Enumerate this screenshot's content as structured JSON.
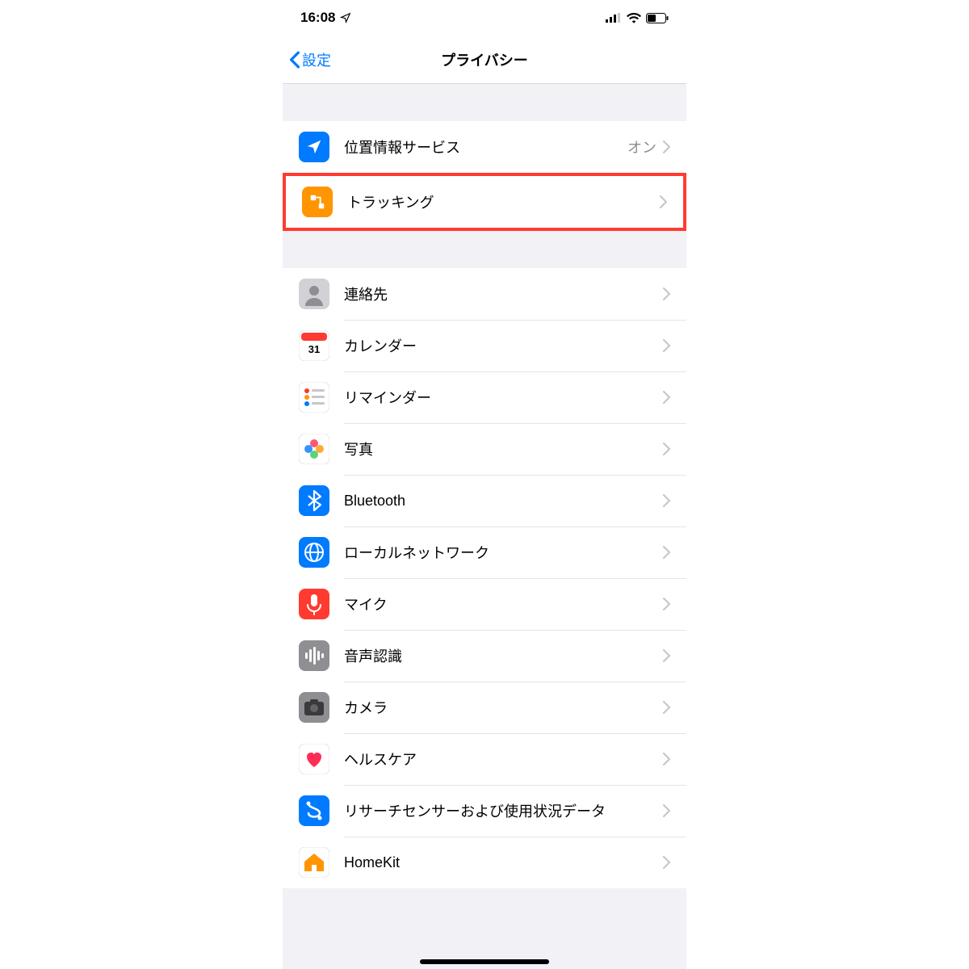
{
  "status": {
    "time": "16:08"
  },
  "nav": {
    "back": "設定",
    "title": "プライバシー"
  },
  "section1": [
    {
      "label": "位置情報サービス",
      "value": "オン",
      "icon": "location",
      "bg": "#007aff"
    },
    {
      "label": "トラッキング",
      "value": "",
      "icon": "tracking",
      "bg": "#ff9500",
      "highlight": true
    }
  ],
  "section2": [
    {
      "label": "連絡先",
      "icon": "contacts",
      "bg": "#c7c7cc"
    },
    {
      "label": "カレンダー",
      "icon": "calendar",
      "bg": "#ffffff"
    },
    {
      "label": "リマインダー",
      "icon": "reminders",
      "bg": "#ffffff"
    },
    {
      "label": "写真",
      "icon": "photos",
      "bg": "#ffffff"
    },
    {
      "label": "Bluetooth",
      "icon": "bluetooth",
      "bg": "#007aff"
    },
    {
      "label": "ローカルネットワーク",
      "icon": "network",
      "bg": "#007aff"
    },
    {
      "label": "マイク",
      "icon": "mic",
      "bg": "#ff3b30"
    },
    {
      "label": "音声認識",
      "icon": "speech",
      "bg": "#8e8e93"
    },
    {
      "label": "カメラ",
      "icon": "camera",
      "bg": "#8e8e93"
    },
    {
      "label": "ヘルスケア",
      "icon": "health",
      "bg": "#ffffff"
    },
    {
      "label": "リサーチセンサーおよび使用状況データ",
      "icon": "research",
      "bg": "#007aff"
    },
    {
      "label": "HomeKit",
      "icon": "homekit",
      "bg": "#ff9500"
    }
  ]
}
